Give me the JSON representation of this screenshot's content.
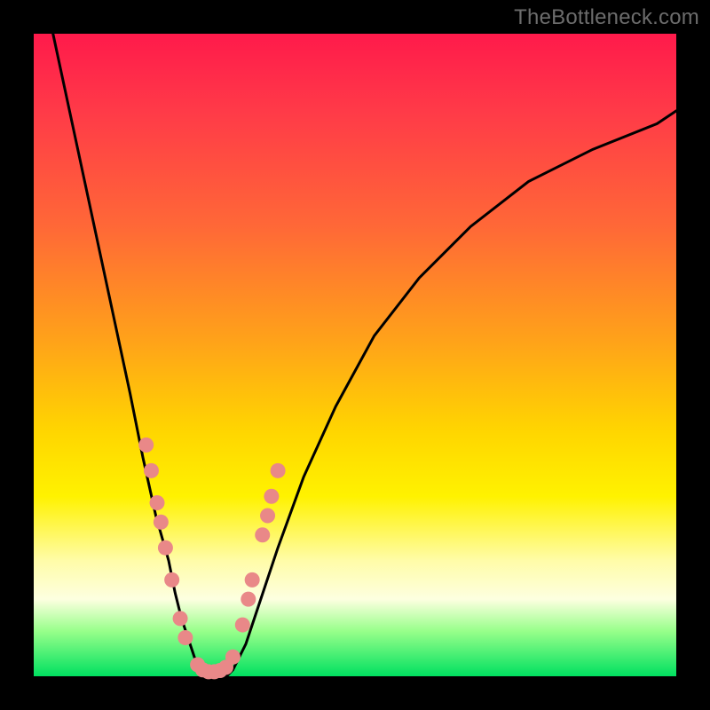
{
  "watermark": "TheBottleneck.com",
  "gradient": {
    "top": "#ff1a4b",
    "mid_orange": "#ffa319",
    "yellow": "#fff200",
    "pale": "#fdffe0",
    "green": "#00e060"
  },
  "chart_data": {
    "type": "line",
    "title": "",
    "xlabel": "",
    "ylabel": "",
    "xlim": [
      0,
      100
    ],
    "ylim": [
      0,
      100
    ],
    "series": [
      {
        "name": "left-arm",
        "x": [
          3,
          6,
          9,
          12,
          15,
          17,
          19,
          21,
          22,
          23,
          24,
          25,
          26,
          27
        ],
        "y": [
          100,
          86,
          72,
          58,
          44,
          34,
          25,
          18,
          13,
          9,
          6,
          3,
          1,
          0
        ]
      },
      {
        "name": "right-arm",
        "x": [
          30,
          31,
          33,
          35,
          38,
          42,
          47,
          53,
          60,
          68,
          77,
          87,
          97,
          100
        ],
        "y": [
          0,
          1,
          5,
          11,
          20,
          31,
          42,
          53,
          62,
          70,
          77,
          82,
          86,
          88
        ]
      }
    ],
    "markers": {
      "name": "salmon-dots",
      "color": "#e98888",
      "points": [
        {
          "x": 17.5,
          "y": 36
        },
        {
          "x": 18.3,
          "y": 32
        },
        {
          "x": 19.2,
          "y": 27
        },
        {
          "x": 19.8,
          "y": 24
        },
        {
          "x": 20.5,
          "y": 20
        },
        {
          "x": 21.5,
          "y": 15
        },
        {
          "x": 22.8,
          "y": 9
        },
        {
          "x": 23.6,
          "y": 6
        },
        {
          "x": 25.5,
          "y": 1.8
        },
        {
          "x": 26.3,
          "y": 1.0
        },
        {
          "x": 27.2,
          "y": 0.7
        },
        {
          "x": 28.1,
          "y": 0.7
        },
        {
          "x": 29.0,
          "y": 0.9
        },
        {
          "x": 29.9,
          "y": 1.4
        },
        {
          "x": 31.0,
          "y": 3
        },
        {
          "x": 32.5,
          "y": 8
        },
        {
          "x": 33.4,
          "y": 12
        },
        {
          "x": 34.0,
          "y": 15
        },
        {
          "x": 35.6,
          "y": 22
        },
        {
          "x": 36.4,
          "y": 25
        },
        {
          "x": 37.0,
          "y": 28
        },
        {
          "x": 38.0,
          "y": 32
        }
      ]
    }
  }
}
